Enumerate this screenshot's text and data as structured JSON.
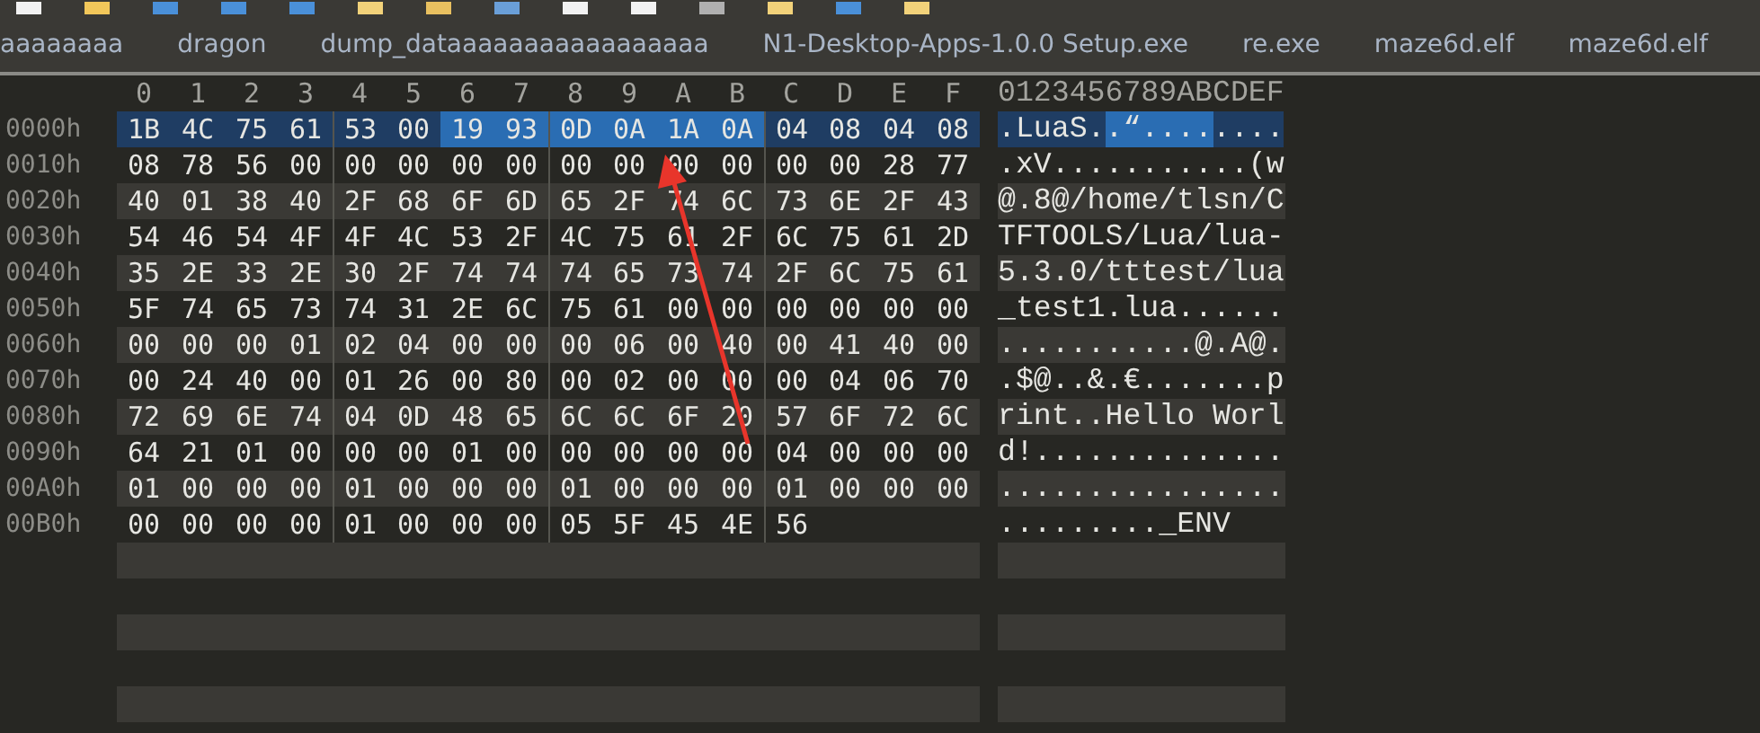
{
  "tabs": [
    {
      "label": "aaaaaaaa"
    },
    {
      "label": "dragon"
    },
    {
      "label": "dump_dataaaaaaaaaaaaaaaaa"
    },
    {
      "label": "N1-Desktop-Apps-1.0.0 Setup.exe"
    },
    {
      "label": "re.exe"
    },
    {
      "label": "maze6d.elf"
    },
    {
      "label": "maze6d.elf"
    }
  ],
  "hex_view": {
    "columns": [
      "0",
      "1",
      "2",
      "3",
      "4",
      "5",
      "6",
      "7",
      "8",
      "9",
      "A",
      "B",
      "C",
      "D",
      "E",
      "F"
    ],
    "ascii_header": "0123456789ABCDEF",
    "rows": [
      {
        "offset": "0000h",
        "selected": true,
        "bytes": [
          "1B",
          "4C",
          "75",
          "61",
          "53",
          "00",
          "19",
          "93",
          "0D",
          "0A",
          "1A",
          "0A",
          "04",
          "08",
          "04",
          "08"
        ],
        "byte_highlighted": [
          false,
          false,
          false,
          false,
          false,
          false,
          true,
          true,
          true,
          true,
          true,
          true,
          false,
          false,
          false,
          false
        ],
        "ascii_parts": [
          {
            "text": ".LuaS.",
            "highlighted": false
          },
          {
            "text": ".“....",
            "highlighted": true
          },
          {
            "text": "....",
            "highlighted": false
          }
        ]
      },
      {
        "offset": "0010h",
        "selected": false,
        "bytes": [
          "08",
          "78",
          "56",
          "00",
          "00",
          "00",
          "00",
          "00",
          "00",
          "00",
          "00",
          "00",
          "00",
          "00",
          "28",
          "77"
        ],
        "ascii": ".xV...........(w"
      },
      {
        "offset": "0020h",
        "selected": false,
        "bytes": [
          "40",
          "01",
          "38",
          "40",
          "2F",
          "68",
          "6F",
          "6D",
          "65",
          "2F",
          "74",
          "6C",
          "73",
          "6E",
          "2F",
          "43"
        ],
        "ascii": "@.8@/home/tlsn/C"
      },
      {
        "offset": "0030h",
        "selected": false,
        "bytes": [
          "54",
          "46",
          "54",
          "4F",
          "4F",
          "4C",
          "53",
          "2F",
          "4C",
          "75",
          "61",
          "2F",
          "6C",
          "75",
          "61",
          "2D"
        ],
        "ascii": "TFTOOLS/Lua/lua-"
      },
      {
        "offset": "0040h",
        "selected": false,
        "bytes": [
          "35",
          "2E",
          "33",
          "2E",
          "30",
          "2F",
          "74",
          "74",
          "74",
          "65",
          "73",
          "74",
          "2F",
          "6C",
          "75",
          "61"
        ],
        "ascii": "5.3.0/tttest/lua"
      },
      {
        "offset": "0050h",
        "selected": false,
        "bytes": [
          "5F",
          "74",
          "65",
          "73",
          "74",
          "31",
          "2E",
          "6C",
          "75",
          "61",
          "00",
          "00",
          "00",
          "00",
          "00",
          "00"
        ],
        "ascii": "_test1.lua......"
      },
      {
        "offset": "0060h",
        "selected": false,
        "bytes": [
          "00",
          "00",
          "00",
          "01",
          "02",
          "04",
          "00",
          "00",
          "00",
          "06",
          "00",
          "40",
          "00",
          "41",
          "40",
          "00"
        ],
        "ascii": "...........@.A@."
      },
      {
        "offset": "0070h",
        "selected": false,
        "bytes": [
          "00",
          "24",
          "40",
          "00",
          "01",
          "26",
          "00",
          "80",
          "00",
          "02",
          "00",
          "00",
          "00",
          "04",
          "06",
          "70"
        ],
        "ascii": ".$@..&.€.......p"
      },
      {
        "offset": "0080h",
        "selected": false,
        "bytes": [
          "72",
          "69",
          "6E",
          "74",
          "04",
          "0D",
          "48",
          "65",
          "6C",
          "6C",
          "6F",
          "20",
          "57",
          "6F",
          "72",
          "6C"
        ],
        "ascii": "rint..Hello Worl"
      },
      {
        "offset": "0090h",
        "selected": false,
        "bytes": [
          "64",
          "21",
          "01",
          "00",
          "00",
          "00",
          "01",
          "00",
          "00",
          "00",
          "00",
          "00",
          "04",
          "00",
          "00",
          "00"
        ],
        "ascii": "d!.............."
      },
      {
        "offset": "00A0h",
        "selected": false,
        "bytes": [
          "01",
          "00",
          "00",
          "00",
          "01",
          "00",
          "00",
          "00",
          "01",
          "00",
          "00",
          "00",
          "01",
          "00",
          "00",
          "00"
        ],
        "ascii": "................"
      },
      {
        "offset": "00B0h",
        "selected": false,
        "bytes": [
          "00",
          "00",
          "00",
          "00",
          "01",
          "00",
          "00",
          "00",
          "05",
          "5F",
          "45",
          "4E",
          "56"
        ],
        "ascii": "........._ENV"
      }
    ]
  }
}
